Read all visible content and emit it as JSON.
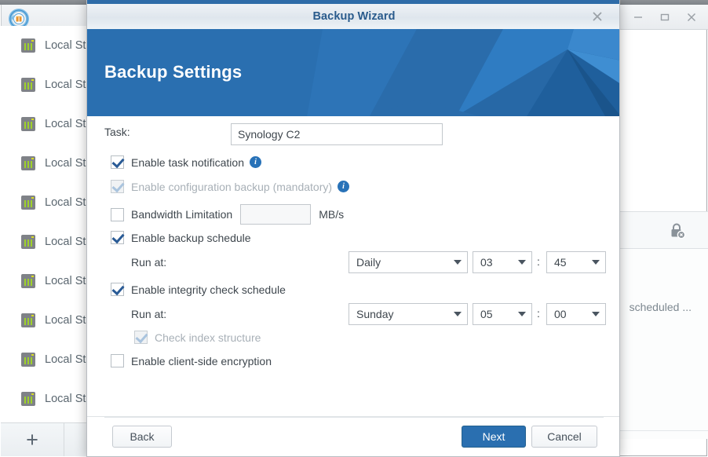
{
  "background_window": {
    "app_icon": "backup-app-icon",
    "window_controls": {
      "minimize": "minimize-icon",
      "maximize": "maximize-icon",
      "close": "close-icon"
    },
    "sidebar": {
      "items": [
        {
          "icon": "storage-server-icon",
          "label": "Local Sto"
        },
        {
          "icon": "storage-server-icon",
          "label": "Local Sto"
        },
        {
          "icon": "storage-server-icon",
          "label": "Local Sto"
        },
        {
          "icon": "storage-server-icon",
          "label": "Local Sto"
        },
        {
          "icon": "storage-server-icon",
          "label": "Local Sto"
        },
        {
          "icon": "storage-server-icon",
          "label": "Local Sto"
        },
        {
          "icon": "storage-server-icon",
          "label": "Local Sto"
        },
        {
          "icon": "storage-server-icon",
          "label": "Local Sto"
        },
        {
          "icon": "storage-server-icon",
          "label": "Local Sto"
        },
        {
          "icon": "storage-server-icon",
          "label": "Local Sto"
        }
      ],
      "add_button_label": "+"
    },
    "panel": {
      "lock_icon": "lock-disabled-icon",
      "row_text": "scheduled ..."
    }
  },
  "dialog": {
    "title": "Backup Wizard",
    "close_icon": "close-icon",
    "banner_title": "Backup Settings",
    "banner_color": "#2a6fb0",
    "accent_color": "#2a6fb0",
    "form": {
      "task_label": "Task:",
      "task_value": "Synology C2",
      "task_placeholder": "",
      "task_notification": {
        "label": "Enable task notification",
        "checked": true,
        "disabled": false,
        "info_icon": "info-icon",
        "info_glyph": "i"
      },
      "config_backup": {
        "label": "Enable configuration backup (mandatory)",
        "checked": true,
        "disabled": true,
        "info_icon": "info-icon",
        "info_glyph": "i"
      },
      "bandwidth": {
        "label": "Bandwidth Limitation",
        "checked": false,
        "value": "",
        "placeholder": "",
        "unit": "MB/s"
      },
      "backup_schedule": {
        "label": "Enable backup schedule",
        "checked": true,
        "run_at_label": "Run at:",
        "frequency": "Daily",
        "hour": "03",
        "separator": ":",
        "minute": "45"
      },
      "integrity_schedule": {
        "label": "Enable integrity check schedule",
        "checked": true,
        "run_at_label": "Run at:",
        "frequency": "Sunday",
        "hour": "05",
        "separator": ":",
        "minute": "00"
      },
      "check_index": {
        "label": "Check index structure",
        "checked": true,
        "disabled": true
      },
      "client_encryption": {
        "label": "Enable client-side encryption",
        "checked": false,
        "disabled": false
      }
    },
    "footer": {
      "back_label": "Back",
      "next_label": "Next",
      "cancel_label": "Cancel"
    }
  }
}
